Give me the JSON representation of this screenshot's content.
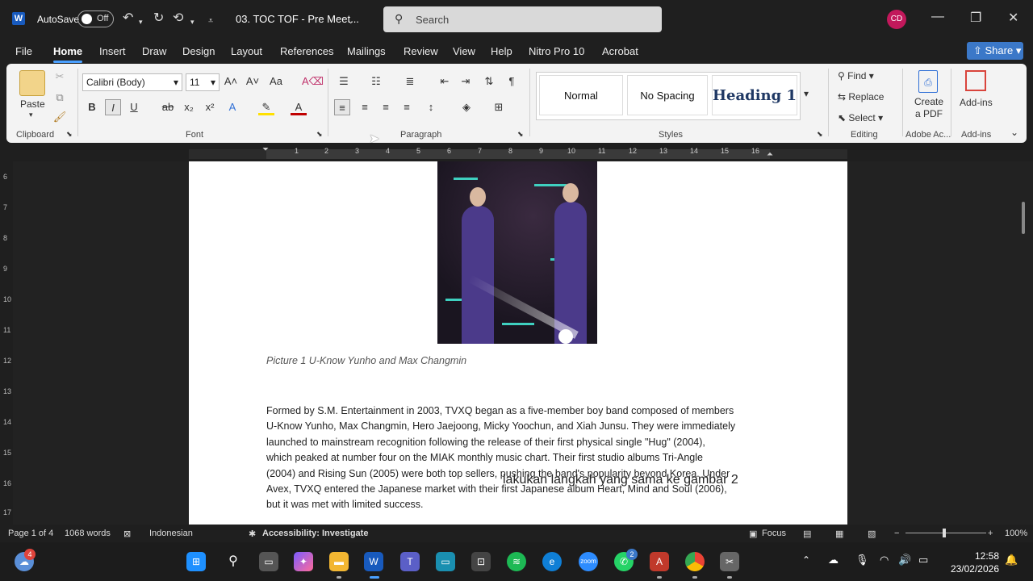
{
  "titlebar": {
    "autosave_label": "AutoSave",
    "autosave_state": "Off",
    "doc_title": "03. TOC TOF - Pre Meet...",
    "search_placeholder": "Search",
    "avatar_initials": "CD"
  },
  "menu": {
    "tabs": [
      "File",
      "Home",
      "Insert",
      "Draw",
      "Design",
      "Layout",
      "References",
      "Mailings",
      "Review",
      "View",
      "Help",
      "Nitro Pro 10",
      "Acrobat"
    ],
    "active": "Home",
    "share_label": "Share"
  },
  "ribbon": {
    "clipboard": {
      "paste_label": "Paste",
      "group_label": "Clipboard"
    },
    "font": {
      "font_name": "Calibri (Body)",
      "font_size": "11",
      "group_label": "Font",
      "bold": "B",
      "italic": "I",
      "underline": "U"
    },
    "paragraph": {
      "group_label": "Paragraph"
    },
    "styles": {
      "items": [
        "Normal",
        "No Spacing",
        "Heading 1"
      ],
      "group_label": "Styles"
    },
    "editing": {
      "find": "Find",
      "replace": "Replace",
      "select": "Select",
      "group_label": "Editing"
    },
    "adobe": {
      "label": "Create a PDF",
      "label_line1": "Create",
      "label_line2": "a PDF",
      "group_label": "Adobe Ac..."
    },
    "addins": {
      "label": "Add-ins",
      "group_label": "Add-ins"
    }
  },
  "ruler": {
    "numbers": [
      "1",
      "2",
      "3",
      "4",
      "5",
      "6",
      "7",
      "8",
      "9",
      "10",
      "11",
      "12",
      "13",
      "14",
      "15",
      "16"
    ],
    "vertical_numbers": [
      "6",
      "7",
      "8",
      "9",
      "10",
      "11",
      "12",
      "13",
      "14",
      "15",
      "16",
      "17"
    ]
  },
  "document": {
    "caption": "Picture 1 U-Know Yunho and Max Changmin",
    "paragraph_lines": [
      "Formed by S.M. Entertainment in 2003, TVXQ began as a five-member boy band composed of members",
      "U-Know Yunho, Max Changmin, Hero Jaejoong, Micky Yoochun, and Xiah Junsu. They were immediately",
      "launched to mainstream recognition following the release of their first physical single \"Hug\" (2004),",
      "which peaked at number four on the MIAK monthly music chart. Their first studio albums Tri-Angle",
      "(2004) and Rising Sun (2005) were both top sellers, pushing the band's popularity beyond Korea. Under",
      "Avex, TVXQ entered the Japanese market with their first Japanese album Heart, Mind and Soul (2006),",
      "but it was met with limited success."
    ],
    "overlay_subtitle": "lakukan langkah yang sama ke gambar 2"
  },
  "statusbar": {
    "page": "Page 1 of 4",
    "words": "1068 words",
    "language": "Indonesian",
    "accessibility": "Accessibility: Investigate",
    "focus": "Focus",
    "zoom": "100%"
  },
  "taskbar": {
    "weather_badge": "4",
    "whatsapp_badge": "2",
    "zoom_label": "zoom",
    "time": "12:58",
    "date": "23/02/2026"
  }
}
